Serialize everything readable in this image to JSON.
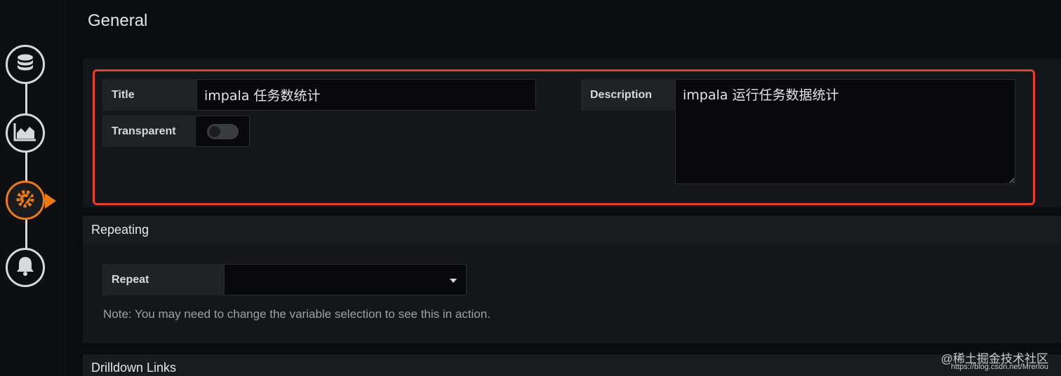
{
  "sidebar": {
    "items": [
      {
        "icon": "database-icon",
        "active": false
      },
      {
        "icon": "area-chart-icon",
        "active": false
      },
      {
        "icon": "settings-icon",
        "active": true
      },
      {
        "icon": "bell-icon",
        "active": false
      }
    ]
  },
  "page": {
    "title": "General"
  },
  "general": {
    "title_label": "Title",
    "title_value": "impala 任务数统计",
    "transparent_label": "Transparent",
    "transparent_on": false,
    "description_label": "Description",
    "description_value": "impala 运行任务数据统计"
  },
  "repeating": {
    "heading": "Repeating",
    "repeat_label": "Repeat",
    "repeat_value": "",
    "note": "Note: You may need to change the variable selection to see this in action."
  },
  "drilldown": {
    "heading": "Drilldown Links"
  },
  "watermark": {
    "line1": "@稀土掘金技术社区",
    "line2": "https://blog.csdn.net/Mrerlou"
  },
  "colors": {
    "accent": "#eb7b18",
    "highlight_border": "#e4402f"
  }
}
